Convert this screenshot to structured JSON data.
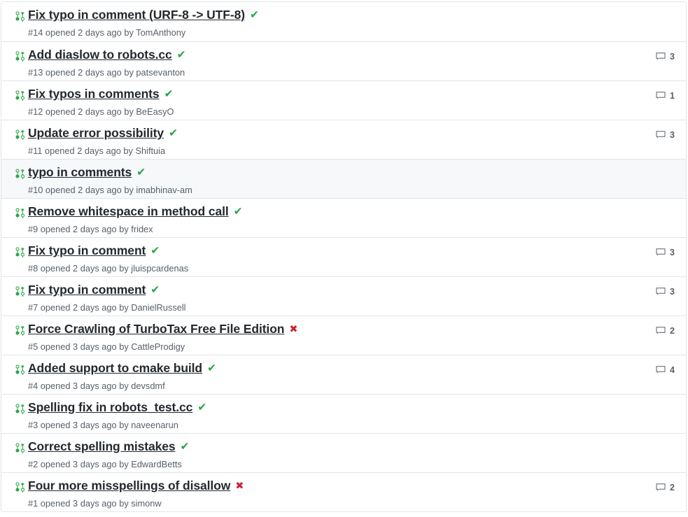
{
  "colors": {
    "pr_icon_green": "#28a745",
    "check_green": "#28a745",
    "x_red": "#cb2431",
    "title_text": "#24292e",
    "meta_text": "#586069",
    "border": "#e1e4e8",
    "row_highlight_bg": "#f6f8fa",
    "row_bg": "#ffffff"
  },
  "icons": {
    "pull_request": "git-pull-request-icon",
    "comment": "comment-bubble-icon",
    "check": "check-icon",
    "cross": "x-icon"
  },
  "glyphs": {
    "check": "✔",
    "cross": "✖"
  },
  "pull_requests": [
    {
      "number": "#14",
      "title": "Fix typo in comment (URF-8 -> UTF-8)",
      "status": "ok",
      "meta": "#14 opened 2 days ago by TomAnthony",
      "opened": "opened 2 days ago by",
      "author": "TomAnthony",
      "comments": "",
      "highlighted": false
    },
    {
      "number": "#13",
      "title": "Add diaslow to robots.cc",
      "status": "ok",
      "meta": "#13 opened 2 days ago by patsevanton",
      "opened": "opened 2 days ago by",
      "author": "patsevanton",
      "comments": "3",
      "highlighted": false
    },
    {
      "number": "#12",
      "title": "Fix typos in comments",
      "status": "ok",
      "meta": "#12 opened 2 days ago by BeEasyO",
      "opened": "opened 2 days ago by",
      "author": "BeEasyO",
      "comments": "1",
      "highlighted": false
    },
    {
      "number": "#11",
      "title": "Update error possibility",
      "status": "ok",
      "meta": "#11 opened 2 days ago by Shiftuia",
      "opened": "opened 2 days ago by",
      "author": "Shiftuia",
      "comments": "3",
      "highlighted": false
    },
    {
      "number": "#10",
      "title": "typo in comments",
      "status": "ok",
      "meta": "#10 opened 2 days ago by imabhinav-am",
      "opened": "opened 2 days ago by",
      "author": "imabhinav-am",
      "comments": "",
      "highlighted": true
    },
    {
      "number": "#9",
      "title": "Remove whitespace in method call",
      "status": "ok",
      "meta": "#9 opened 2 days ago by fridex",
      "opened": "opened 2 days ago by",
      "author": "fridex",
      "comments": "",
      "highlighted": false
    },
    {
      "number": "#8",
      "title": "Fix typo in comment",
      "status": "ok",
      "meta": "#8 opened 2 days ago by jluispcardenas",
      "opened": "opened 2 days ago by",
      "author": "jluispcardenas",
      "comments": "3",
      "highlighted": false
    },
    {
      "number": "#7",
      "title": "Fix typo in comment",
      "status": "ok",
      "meta": "#7 opened 2 days ago by DanielRussell",
      "opened": "opened 2 days ago by",
      "author": "DanielRussell",
      "comments": "3",
      "highlighted": false
    },
    {
      "number": "#5",
      "title": "Force Crawling of TurboTax Free File Edition",
      "status": "fail",
      "meta": "#5 opened 3 days ago by CattleProdigy",
      "opened": "opened 3 days ago by",
      "author": "CattleProdigy",
      "comments": "2",
      "highlighted": false
    },
    {
      "number": "#4",
      "title": "Added support to cmake build",
      "status": "ok",
      "meta": "#4 opened 3 days ago by devsdmf",
      "opened": "opened 3 days ago by",
      "author": "devsdmf",
      "comments": "4",
      "highlighted": false
    },
    {
      "number": "#3",
      "title": "Spelling fix in robots_test.cc",
      "status": "ok",
      "meta": "#3 opened 3 days ago by naveenarun",
      "opened": "opened 3 days ago by",
      "author": "naveenarun",
      "comments": "",
      "highlighted": false
    },
    {
      "number": "#2",
      "title": "Correct spelling mistakes",
      "status": "ok",
      "meta": "#2 opened 3 days ago by EdwardBetts",
      "opened": "opened 3 days ago by",
      "author": "EdwardBetts",
      "comments": "",
      "highlighted": false
    },
    {
      "number": "#1",
      "title": "Four more misspellings of disallow",
      "status": "fail",
      "meta": "#1 opened 3 days ago by simonw",
      "opened": "opened 3 days ago by",
      "author": "simonw",
      "comments": "2",
      "highlighted": false
    }
  ]
}
